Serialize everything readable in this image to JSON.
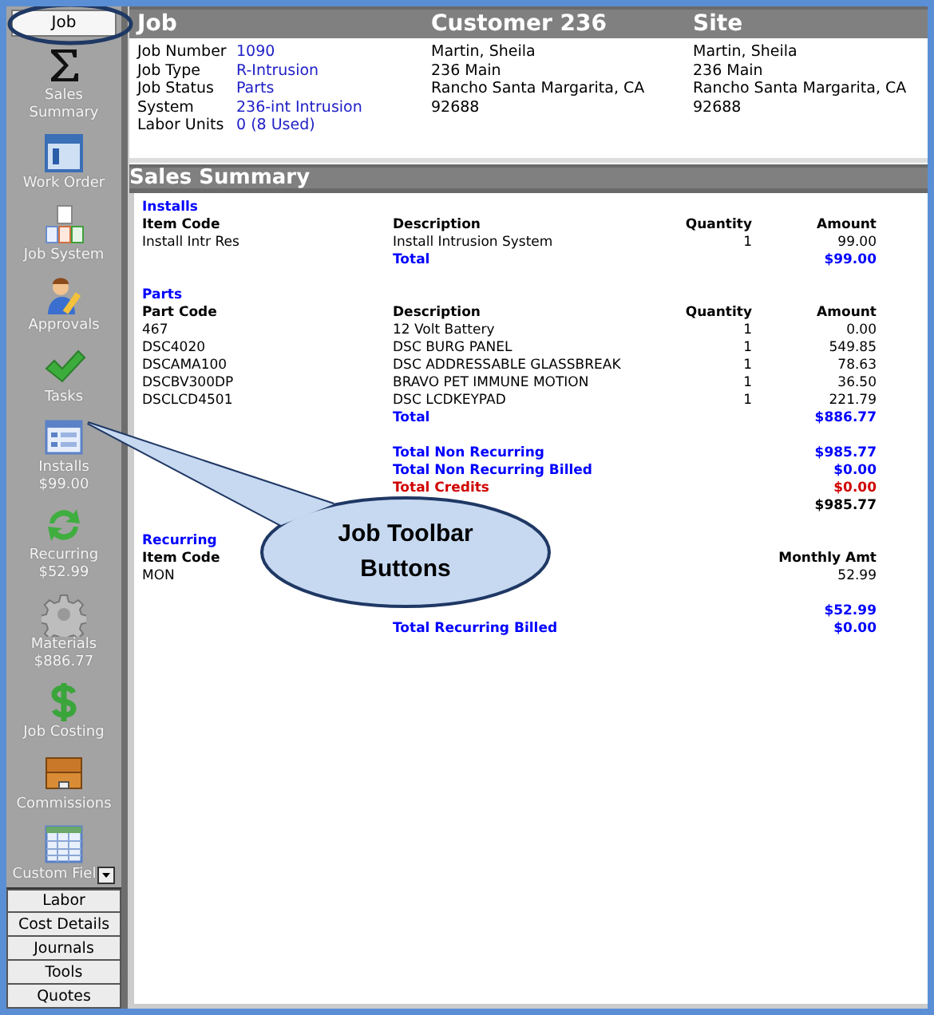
{
  "sidebar": {
    "top_button": {
      "label": "Job",
      "selected": true
    },
    "items": [
      {
        "kind": "sigma",
        "label": "Sales Summary"
      },
      {
        "kind": "window",
        "label": "Work Order"
      },
      {
        "kind": "documents",
        "label": "Job System"
      },
      {
        "kind": "person",
        "label": "Approvals"
      },
      {
        "kind": "check",
        "label": "Tasks"
      },
      {
        "kind": "list",
        "label": "Installs",
        "amount": "$99.00"
      },
      {
        "kind": "arrows",
        "label": "Recurring",
        "amount": "$52.99"
      },
      {
        "kind": "gear",
        "label": "Materials",
        "amount": "$886.77"
      },
      {
        "kind": "dollar",
        "label": "Job Costing"
      },
      {
        "kind": "chest",
        "label": "Commissions"
      },
      {
        "kind": "table",
        "label": "Custom Fiel",
        "dropdown": true
      }
    ],
    "bottom_buttons": [
      "Labor",
      "Cost Details",
      "Journals",
      "Tools",
      "Quotes"
    ]
  },
  "header": {
    "titles": [
      "Job",
      "Customer 236",
      "Site"
    ],
    "job_fields": [
      {
        "label": "Job Number",
        "value": "1090"
      },
      {
        "label": "Job Type",
        "value": "R-Intrusion"
      },
      {
        "label": "Job Status",
        "value": "Parts"
      },
      {
        "label": "System",
        "value": "236-int Intrusion"
      },
      {
        "label": "Labor Units",
        "value": "0 (8 Used)"
      }
    ],
    "customer_lines": [
      "Martin, Sheila",
      "236 Main",
      "Rancho Santa Margarita, CA",
      "92688"
    ],
    "site_lines": [
      "Martin, Sheila",
      "236 Main",
      "Rancho Santa Margarita, CA",
      "92688"
    ]
  },
  "sales_summary": {
    "title": "Sales Summary",
    "installs": {
      "title": "Installs",
      "columns": [
        "Item Code",
        "Description",
        "Quantity",
        "Amount"
      ],
      "rows": [
        [
          "Install Intr Res",
          "Install Intrusion System",
          "1",
          "99.00"
        ]
      ],
      "total": {
        "label": "Total",
        "amount": "$99.00"
      }
    },
    "parts": {
      "title": "Parts",
      "columns": [
        "Part Code",
        "Description",
        "Quantity",
        "Amount"
      ],
      "rows": [
        [
          "467",
          "12 Volt Battery",
          "1",
          "0.00"
        ],
        [
          "DSC4020",
          "DSC BURG PANEL",
          "1",
          "549.85"
        ],
        [
          "DSCAMA100",
          "DSC ADDRESSABLE GLASSBREAK",
          "1",
          "78.63"
        ],
        [
          "DSCBV300DP",
          "BRAVO PET IMMUNE MOTION",
          "1",
          "36.50"
        ],
        [
          "DSCLCD4501",
          "DSC LCDKEYPAD",
          "1",
          "221.79"
        ]
      ],
      "total": {
        "label": "Total",
        "amount": "$886.77"
      }
    },
    "summary_lines": [
      {
        "kind": "total",
        "label": "Total Non Recurring",
        "amount": "$985.77"
      },
      {
        "kind": "total",
        "label": "Total Non Recurring Billed",
        "amount": "$0.00"
      },
      {
        "kind": "credit",
        "label": "Total Credits",
        "amount": "$0.00"
      },
      {
        "kind": "net",
        "amount": "$985.77"
      }
    ],
    "recurring": {
      "title": "Recurring",
      "columns": [
        "Item Code",
        "Monthly Amt"
      ],
      "rows": [
        [
          "MON",
          "52.99"
        ]
      ],
      "totals": [
        {
          "kind": "total",
          "amount": "$52.99"
        },
        {
          "kind": "total",
          "label": "Total Recurring Billed",
          "amount": "$0.00"
        }
      ]
    }
  },
  "callout": {
    "text": "Job Toolbar Buttons"
  }
}
